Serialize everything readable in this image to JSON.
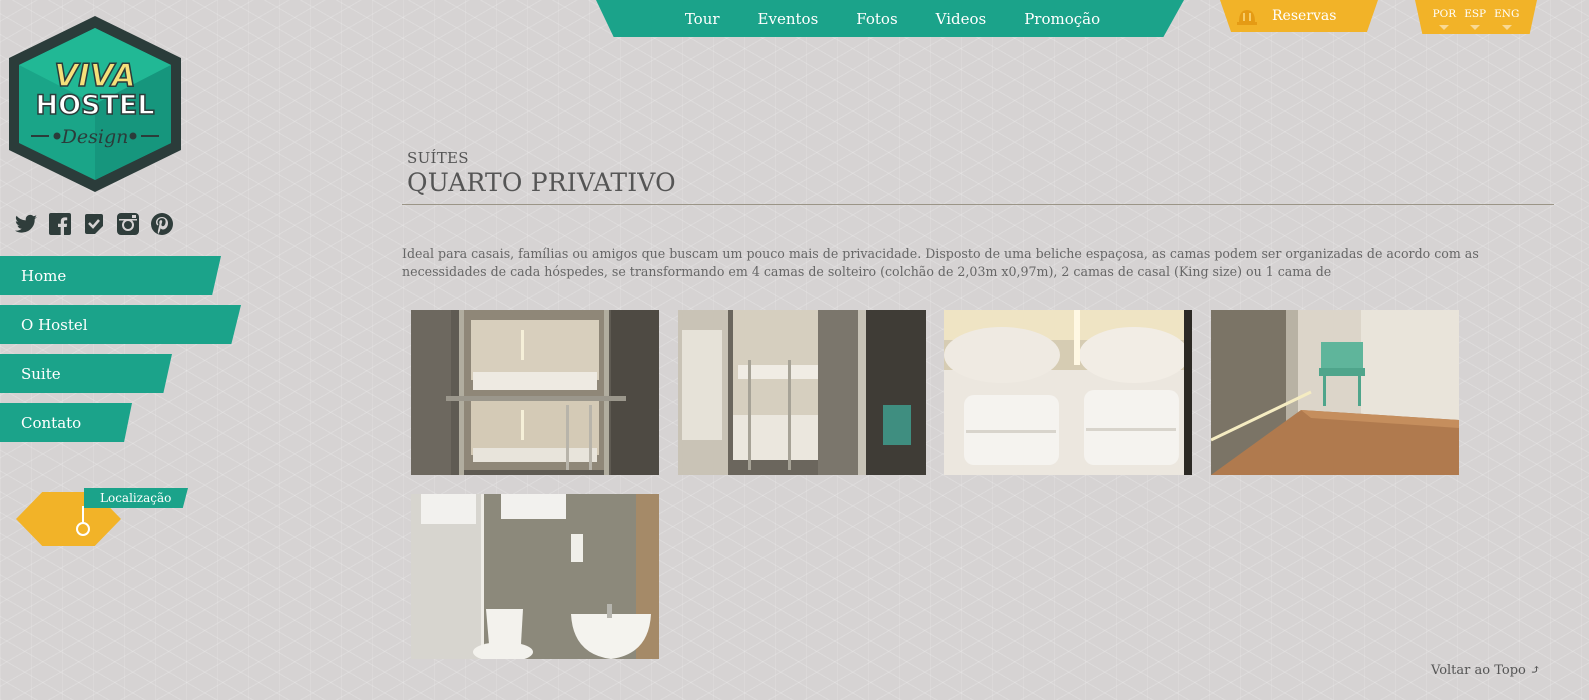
{
  "header": {
    "nav": [
      "Tour",
      "Eventos",
      "Fotos",
      "Videos",
      "Promoção"
    ],
    "reservas_label": "Reservas",
    "languages": [
      "POR",
      "ESP",
      "ENG"
    ]
  },
  "logo": {
    "line1": "VIVA",
    "line2": "HOSTEL",
    "line3": "Design"
  },
  "social": [
    "twitter-icon",
    "facebook-icon",
    "foursquare-icon",
    "instagram-icon",
    "pinterest-icon"
  ],
  "sidebar": {
    "items": [
      {
        "label": "Home"
      },
      {
        "label": "O Hostel"
      },
      {
        "label": "Suite"
      },
      {
        "label": "Contato"
      }
    ],
    "location_label": "Localização"
  },
  "main": {
    "category": "SUÍTES",
    "title": "QUARTO PRIVATIVO",
    "description": "Ideal para casais, famílias ou amigos que buscam um pouco mais de privacidade. Disposto de uma beliche espaçosa, as camas podem ser organizadas de acordo com as necessidades de cada hóspedes, se transformando em 4 camas de solteiro (colchão de 2,03m x0,97m), 2 camas de casal (King size) ou 1 cama de",
    "photos": [
      "bunk-bed-photo",
      "bunk-bed-window-photo",
      "towels-bed-photo",
      "hallway-cabinet-photo",
      "bathroom-photo"
    ]
  },
  "footer": {
    "back_to_top": "Voltar ao Topo ⤴"
  },
  "colors": {
    "teal": "#1ba38a",
    "yellow": "#f2b328",
    "background": "#d6d3d3",
    "logo_dark": "#2b3c3a"
  }
}
